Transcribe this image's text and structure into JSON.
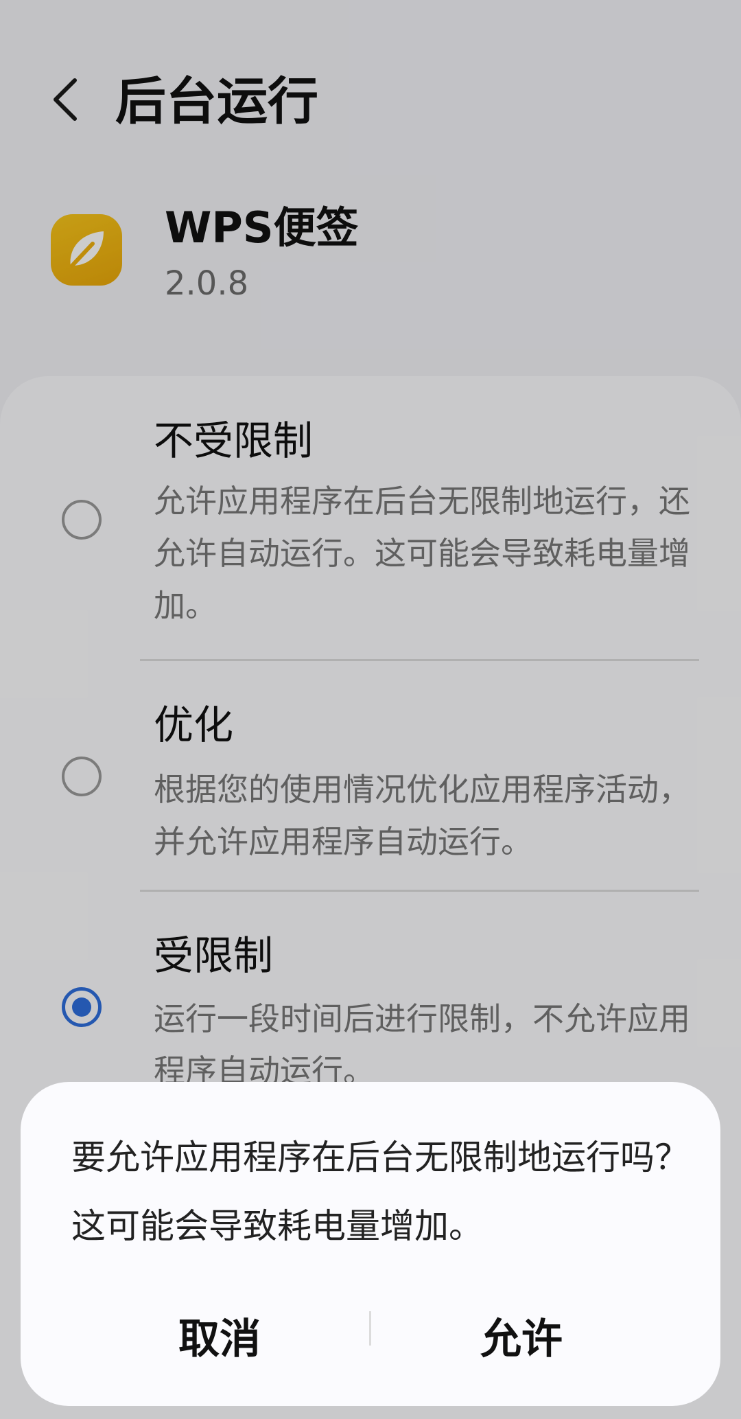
{
  "header": {
    "title": "后台运行",
    "back_icon": "chevron-left-icon"
  },
  "app": {
    "name": "WPS便签",
    "version": "2.0.8",
    "icon": "leaf-icon",
    "icon_color": "#F2B40F"
  },
  "options": [
    {
      "title": "不受限制",
      "description": "允许应用程序在后台无限制地运行，还允许自动运行。这可能会导致耗电量增加。",
      "selected": false
    },
    {
      "title": "优化",
      "description": "根据您的使用情况优化应用程序活动，并允许应用程序自动运行。",
      "selected": false
    },
    {
      "title": "受限制",
      "description": "运行一段时间后进行限制，不允许应用程序自动运行。",
      "selected": true
    }
  ],
  "dialog": {
    "message": "要允许应用程序在后台无限制地运行吗？这可能会导致耗电量增加。",
    "cancel_label": "取消",
    "confirm_label": "允许"
  },
  "colors": {
    "accent": "#2F6FDC",
    "background": "#F3F3F7"
  }
}
